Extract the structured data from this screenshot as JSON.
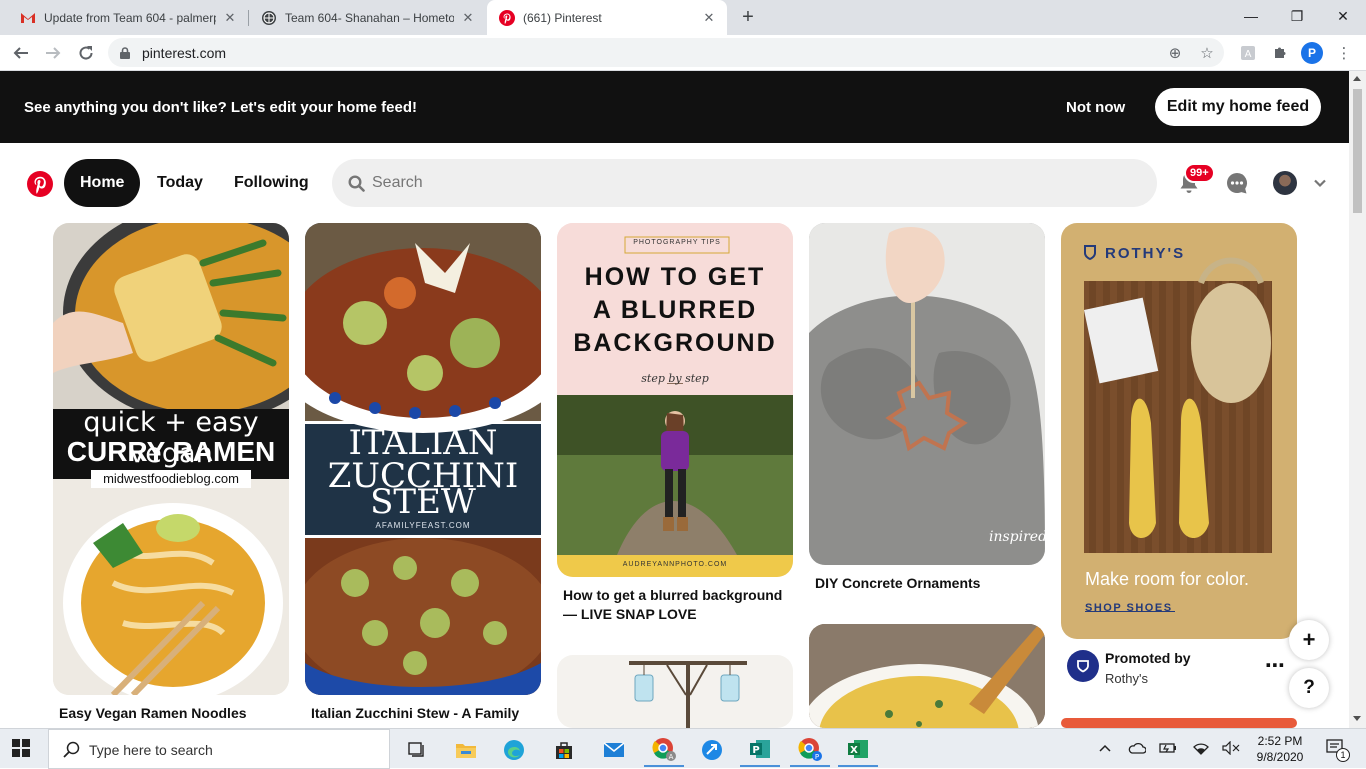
{
  "browser": {
    "tabs": [
      {
        "title": "Update from Team 604 - palmerp",
        "icon": "gmail-icon"
      },
      {
        "title": "Team 604- Shanahan – Hometow",
        "icon": "globe-icon"
      },
      {
        "title": "(661) Pinterest",
        "icon": "pinterest-icon",
        "active": true
      }
    ],
    "url": "pinterest.com"
  },
  "banner": {
    "message": "See anything you don't like? Let's edit your home feed!",
    "not_now": "Not now",
    "edit_button": "Edit my home feed"
  },
  "header": {
    "nav": [
      "Home",
      "Today",
      "Following"
    ],
    "search_placeholder": "Search",
    "notifications_badge": "99+"
  },
  "pins": {
    "ramen": {
      "title": "Easy Vegan Ramen Noodles",
      "overlay_line1": "quick + easy vegan",
      "overlay_line2": "CURRY RAMEN",
      "overlay_site": "midwestfoodieblog.com"
    },
    "zucchini": {
      "title": "Italian Zucchini Stew - A Family",
      "overlay_line1": "ITALIAN",
      "overlay_line2": "ZUCCHINI",
      "overlay_line3": "STEW",
      "overlay_site": "AFAMILYFEAST.COM"
    },
    "blurred": {
      "tag": "PHOTOGRAPHY TIPS",
      "heading_line1": "HOW TO GET",
      "heading_line2": "A BLURRED",
      "heading_line3": "BACKGROUND",
      "subheading": "step by step",
      "footer": "AUDREYANNPHOTO.COM",
      "title": "How to get a blurred background — LIVE SNAP LOVE"
    },
    "concrete": {
      "title": "DIY Concrete Ornaments",
      "watermark": "inspired"
    },
    "rothys": {
      "brand": "ROTHY'S",
      "tagline": "Make room for color.",
      "cta": "SHOP SHOES",
      "promoted_by": "Promoted by",
      "advertiser": "Rothy's"
    }
  },
  "fab": {
    "add": "+",
    "help": "?"
  },
  "taskbar": {
    "search_placeholder": "Type here to search",
    "time": "2:52 PM",
    "date": "9/8/2020",
    "notification_count": "1"
  },
  "colors": {
    "pinterest_red": "#e60023",
    "banner_bg": "#111111",
    "rothys_bg": "#d2b071",
    "zucchini_band": "#1f3346",
    "blurred_top": "#f7dcd9"
  }
}
